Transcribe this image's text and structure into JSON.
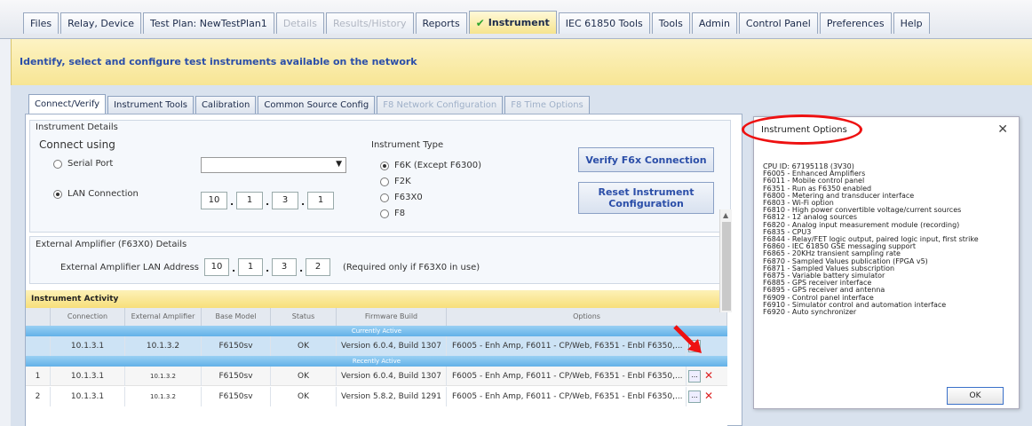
{
  "top_tabs": [
    {
      "label": "Files",
      "state": "normal"
    },
    {
      "label": "Relay, Device",
      "state": "normal"
    },
    {
      "label": "Test Plan: NewTestPlan1",
      "state": "normal"
    },
    {
      "label": "Details",
      "state": "disabled"
    },
    {
      "label": "Results/History",
      "state": "disabled"
    },
    {
      "label": "Reports",
      "state": "normal"
    },
    {
      "label": "Instrument",
      "state": "active"
    },
    {
      "label": "IEC 61850 Tools",
      "state": "normal"
    },
    {
      "label": "Tools",
      "state": "normal"
    },
    {
      "label": "Admin",
      "state": "normal"
    },
    {
      "label": "Control Panel",
      "state": "normal"
    },
    {
      "label": "Preferences",
      "state": "normal"
    },
    {
      "label": "Help",
      "state": "normal"
    }
  ],
  "banner": "Identify, select and configure test instruments available on the network",
  "sub_tabs": [
    {
      "label": "Connect/Verify",
      "state": "active"
    },
    {
      "label": "Instrument Tools",
      "state": "normal"
    },
    {
      "label": "Calibration",
      "state": "normal"
    },
    {
      "label": "Common Source Config",
      "state": "normal"
    },
    {
      "label": "F8 Network Configuration",
      "state": "disabled"
    },
    {
      "label": "F8 Time Options",
      "state": "disabled"
    }
  ],
  "details": {
    "title": "Instrument Details",
    "connect_using": "Connect using",
    "serial_port": "Serial Port",
    "lan_connection": "LAN Connection",
    "ip": [
      "10",
      "1",
      "3",
      "1"
    ],
    "type_title": "Instrument Type",
    "types": [
      "F6K (Except F6300)",
      "F2K",
      "F63X0",
      "F8"
    ],
    "selected_type": "F6K (Except F6300)",
    "verify_button": "Verify F6x Connection",
    "reset_button_1": "Reset Instrument",
    "reset_button_2": "Configuration"
  },
  "amplifier": {
    "title": "External Amplifier (F63X0) Details",
    "label": "External Amplifier LAN Address",
    "ip": [
      "10",
      "1",
      "3",
      "2"
    ],
    "note": "(Required only if F63X0 in use)"
  },
  "activity": {
    "title": "Instrument Activity",
    "headers": [
      "Connection",
      "External Amplifier",
      "Base Model",
      "Status",
      "Firmware Build",
      "Options"
    ],
    "current_label": "Currently Active",
    "recent_label": "Recently Active",
    "current": {
      "num": "",
      "conn": "10.1.3.1",
      "amp": "10.1.3.2",
      "model": "F6150sv",
      "status": "OK",
      "fw": "Version 6.0.4, Build 1307",
      "opts": "F6005 - Enh Amp, F6011 - CP/Web, F6351 - Enbl F6350,..."
    },
    "recent": [
      {
        "num": "1",
        "conn": "10.1.3.1",
        "amp": "10.1.3.2",
        "model": "F6150sv",
        "status": "OK",
        "fw": "Version 6.0.4, Build 1307",
        "opts": "F6005 - Enh Amp, F6011 - CP/Web, F6351 - Enbl F6350,..."
      },
      {
        "num": "2",
        "conn": "10.1.3.1",
        "amp": "10.1.3.2",
        "model": "F6150sv",
        "status": "OK",
        "fw": "Version 5.8.2, Build 1291",
        "opts": "F6005 - Enh Amp, F6011 - CP/Web, F6351 - Enbl F6350,..."
      }
    ],
    "ellipsis": "...",
    "delete": "✕"
  },
  "dialog": {
    "title": "Instrument Options",
    "close": "✕",
    "lines": [
      "CPU ID: 67195118 (3V30)",
      "F6005 - Enhanced Amplifiers",
      "F6011 - Mobile control panel",
      "F6351 - Run as F6350 enabled",
      "F6800 - Metering and transducer interface",
      "F6803 - Wi-Fi option",
      "F6810 - High power convertible voltage/current sources",
      "F6812 - 12 analog sources",
      "F6820 - Analog input measurement module (recording)",
      "F6835 - CPU3",
      "F6844 - Relay/FET logic output, paired logic input, first strike",
      "F6860 - IEC 61850 GSE messaging support",
      "F6865 - 20KHz transient sampling rate",
      "F6870 - Sampled Values publication (FPGA v5)",
      "F6871 - Sampled Values subscription",
      "F6875 - Variable battery simulator",
      "F6885 - GPS receiver interface",
      "F6895 - GPS receiver and antenna",
      "F6909 - Control panel interface",
      "F6910 - Simulator control and automation interface",
      "F6920 - Auto synchronizer"
    ],
    "ok": "OK"
  },
  "colors": {
    "accent": "#2b4ea8",
    "banner": "#f7e594",
    "section": "#63b1e8",
    "highlight": "#e11111"
  }
}
